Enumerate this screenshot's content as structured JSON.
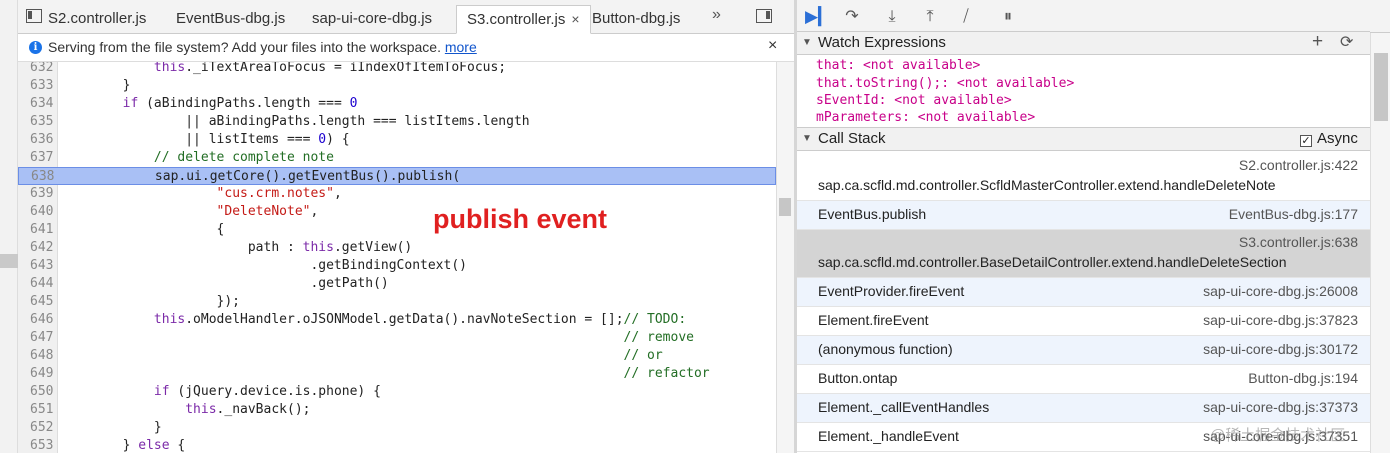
{
  "tabs": [
    {
      "label": "S2.controller.js",
      "active": false
    },
    {
      "label": "EventBus-dbg.js",
      "active": false
    },
    {
      "label": "sap-ui-core-dbg.js",
      "active": false
    },
    {
      "label": "S3.controller.js",
      "active": true
    },
    {
      "label": "Button-dbg.js",
      "active": false
    }
  ],
  "tab_close_glyph": "×",
  "more_tabs_glyph": "»",
  "notice": {
    "message": "Serving from the file system? Add your files into the workspace.",
    "link": "more",
    "close": "×",
    "info": "i"
  },
  "code_lines": [
    {
      "n": "632",
      "text": "            this._iTextAreaToFocus = iIndexOfItemToFocus;"
    },
    {
      "n": "633",
      "text": "        }"
    },
    {
      "n": "634",
      "text": "        if (aBindingPaths.length === 0"
    },
    {
      "n": "635",
      "text": "                || aBindingPaths.length === listItems.length"
    },
    {
      "n": "636",
      "text": "                || listItems === 0) {"
    },
    {
      "n": "637",
      "text": "            // delete complete note"
    },
    {
      "n": "638",
      "text": "            sap.ui.getCore().getEventBus().publish("
    },
    {
      "n": "639",
      "text": "                    \"cus.crm.notes\","
    },
    {
      "n": "640",
      "text": "                    \"DeleteNote\","
    },
    {
      "n": "641",
      "text": "                    {"
    },
    {
      "n": "642",
      "text": "                        path : this.getView()"
    },
    {
      "n": "643",
      "text": "                                .getBindingContext()"
    },
    {
      "n": "644",
      "text": "                                .getPath()"
    },
    {
      "n": "645",
      "text": "                    });"
    },
    {
      "n": "646",
      "text": "            this.oModelHandler.oJSONModel.getData().navNoteSection = [];// TODO:"
    },
    {
      "n": "647",
      "text": "                                                                        // remove"
    },
    {
      "n": "648",
      "text": "                                                                        // or"
    },
    {
      "n": "649",
      "text": "                                                                        // refactor"
    },
    {
      "n": "650",
      "text": "            if (jQuery.device.is.phone) {"
    },
    {
      "n": "651",
      "text": "                this._navBack();"
    },
    {
      "n": "652",
      "text": "            }"
    },
    {
      "n": "653",
      "text": "        } else {"
    }
  ],
  "highlighted_line": "638",
  "annotation": "publish event",
  "watch": {
    "title": "Watch Expressions",
    "add": "+",
    "refresh": "C",
    "items": [
      "that: <not available>",
      "that.toString();: <not available>",
      "sEventId: <not available>",
      "mParameters: <not available>"
    ]
  },
  "callstack": {
    "title": "Call Stack",
    "async_label": "Async",
    "async_checked": true,
    "frames": [
      {
        "fn": "sap.ca.scfld.md.controller.ScfldMasterController.extend.handleDeleteNote",
        "loc": "S2.controller.js:422"
      },
      {
        "fn": "EventBus.publish",
        "loc": "EventBus-dbg.js:177"
      },
      {
        "fn": "sap.ca.scfld.md.controller.BaseDetailController.extend.handleDeleteSection",
        "loc": "S3.controller.js:638"
      },
      {
        "fn": "EventProvider.fireEvent",
        "loc": "sap-ui-core-dbg.js:26008"
      },
      {
        "fn": "Element.fireEvent",
        "loc": "sap-ui-core-dbg.js:37823"
      },
      {
        "fn": "(anonymous function)",
        "loc": "sap-ui-core-dbg.js:30172"
      },
      {
        "fn": "Button.ontap",
        "loc": "Button-dbg.js:194"
      },
      {
        "fn": "Element._callEventHandles",
        "loc": "sap-ui-core-dbg.js:37373"
      },
      {
        "fn": "Element._handleEvent",
        "loc": "sap-ui-core-dbg.js:37351"
      }
    ]
  },
  "debugger_buttons": [
    "resume-icon",
    "step-over-icon",
    "step-into-icon",
    "step-out-icon",
    "deactivate-breakpoints-icon",
    "pause-on-exceptions-icon"
  ],
  "watermark": "@稀土掘金技术社区"
}
